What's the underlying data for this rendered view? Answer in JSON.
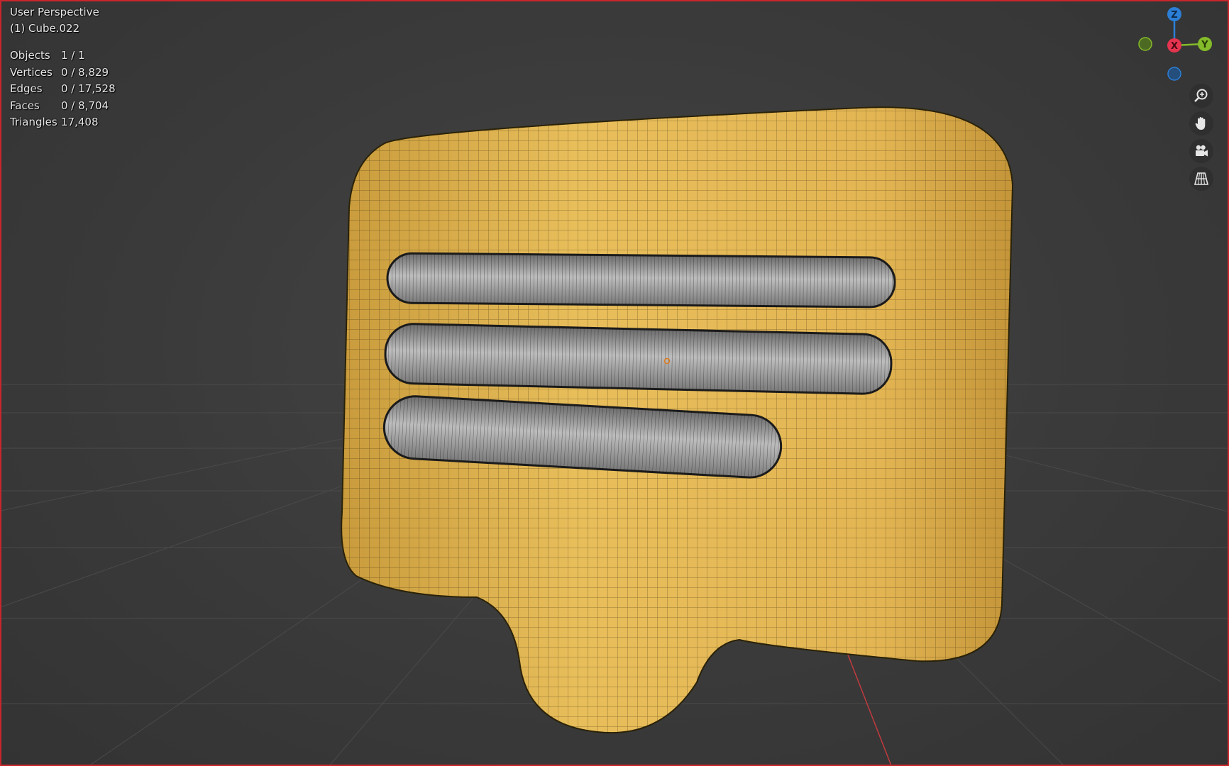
{
  "viewport": {
    "view_name": "User Perspective",
    "active_object": "(1) Cube.022"
  },
  "stats": [
    {
      "label": "Objects",
      "value": "1 / 1"
    },
    {
      "label": "Vertices",
      "value": "0 / 8,829"
    },
    {
      "label": "Edges",
      "value": "0 / 17,528"
    },
    {
      "label": "Faces",
      "value": "0 / 8,704"
    },
    {
      "label": "Triangles",
      "value": "17,408"
    }
  ],
  "gizmo": {
    "z_label": "Z",
    "x_label": "X",
    "y_label": "Y",
    "colors": {
      "x": "#e5344f",
      "y": "#84bb2a",
      "z": "#2c7fd6"
    }
  },
  "nav_buttons": [
    {
      "name": "zoom-button",
      "icon": "magnifier-plus-icon"
    },
    {
      "name": "pan-button",
      "icon": "hand-icon"
    },
    {
      "name": "camera-view-button",
      "icon": "camera-icon"
    },
    {
      "name": "perspective-toggle-button",
      "icon": "grid-perspective-icon"
    }
  ],
  "colors": {
    "background": "#3a3a3a",
    "border": "#c8262b",
    "mesh_fill": "#e3b652",
    "bar_fill": "#a7a7a7",
    "x_axis_line": "#c03a3e"
  }
}
